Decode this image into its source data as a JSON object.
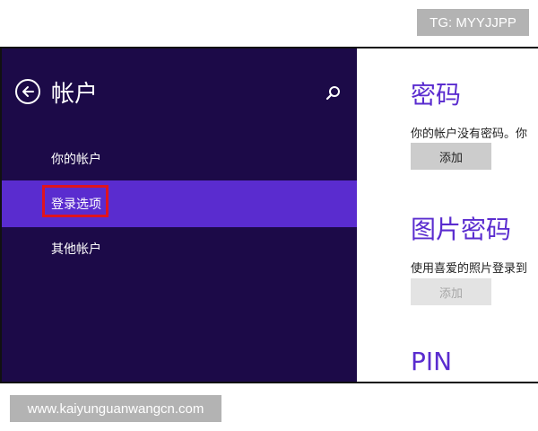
{
  "watermarks": {
    "top": "TG: MYYJJPP",
    "bottom": "www.kaiyunguanwangcn.com"
  },
  "left_pane": {
    "title": "帐户",
    "nav_items": [
      {
        "label": "你的帐户",
        "active": false
      },
      {
        "label": "登录选项",
        "active": true
      },
      {
        "label": "其他帐户",
        "active": false
      }
    ]
  },
  "right_pane": {
    "password": {
      "title": "密码",
      "desc": "你的帐户没有密码。你",
      "button": "添加"
    },
    "picture_password": {
      "title": "图片密码",
      "desc": "使用喜爱的照片登录到",
      "button": "添加"
    },
    "pin": {
      "title": "PIN"
    }
  },
  "colors": {
    "left_bg": "#1c0a48",
    "active_bg": "#5a2ccf",
    "accent": "#5a2ccf",
    "highlight": "#e0141e"
  },
  "icons": [
    "back-arrow-icon",
    "search-icon"
  ]
}
